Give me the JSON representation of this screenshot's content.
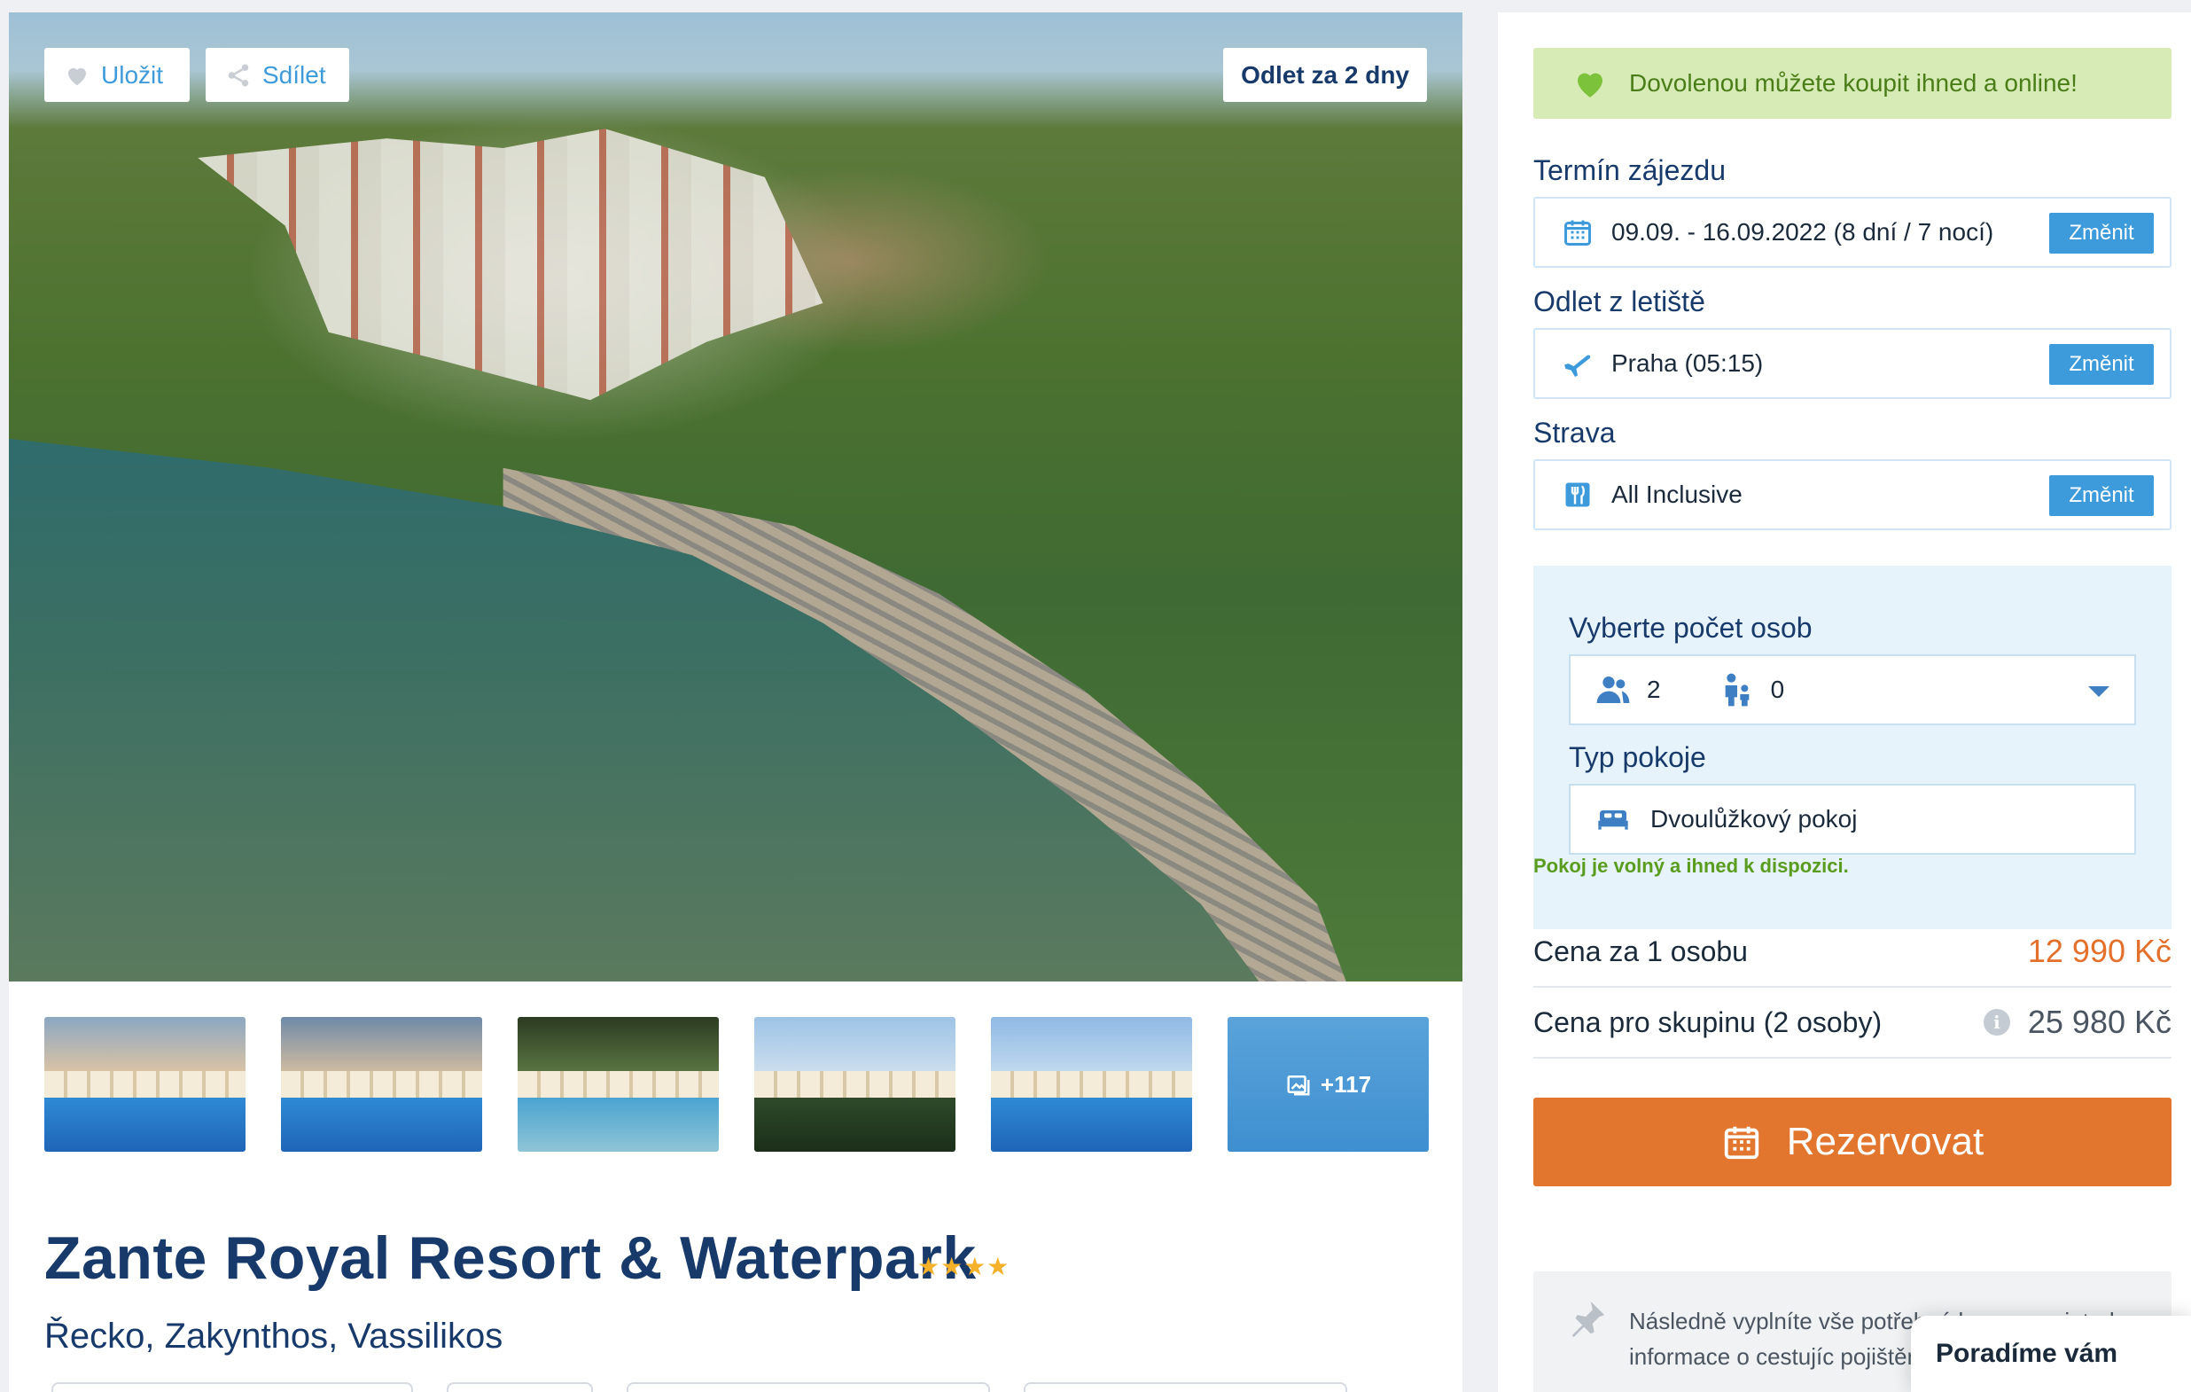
{
  "hero": {
    "save_label": "Uložit",
    "share_label": "Sdílet",
    "departure_badge": "Odlet za 2 dny"
  },
  "gallery": {
    "more_count": "+117"
  },
  "hotel": {
    "name": "Zante Royal Resort & Waterpark",
    "stars": "★★★★",
    "location": "Řecko, Zakynthos, Vassilikos"
  },
  "booking": {
    "notice": "Dovolenou můžete koupit ihned a online!",
    "term_label": "Termín zájezdu",
    "term_value": "09.09. - 16.09.2022 (8 dní / 7 nocí)",
    "airport_label": "Odlet z letiště",
    "airport_value": "Praha (05:15)",
    "board_label": "Strava",
    "board_value": "All Inclusive",
    "change_label": "Změnit",
    "persons_label": "Vyberte počet osob",
    "adults": "2",
    "children": "0",
    "room_label": "Typ pokoje",
    "room_value": "Dvoulůžkový pokoj",
    "availability": "Pokoj je volný a ihned k dispozici.",
    "price_per_person_label": "Cena za 1 osobu",
    "price_per_person": "12 990 Kč",
    "price_group_label": "Cena pro skupinu (2 osoby)",
    "price_group": "25 980 Kč",
    "reserve_label": "Rezervovat",
    "info_text": "Následně vyplníte vše potřebné k rezervaci, tedy informace o cestujíc pojištění a způsob platby."
  },
  "chat": {
    "label": "Poradíme vám"
  },
  "colors": {
    "accent": "#3e9bdb",
    "title": "#173a6b",
    "reserve": "#e3762e",
    "price": "#e3702b",
    "success": "#5a9c1d"
  }
}
